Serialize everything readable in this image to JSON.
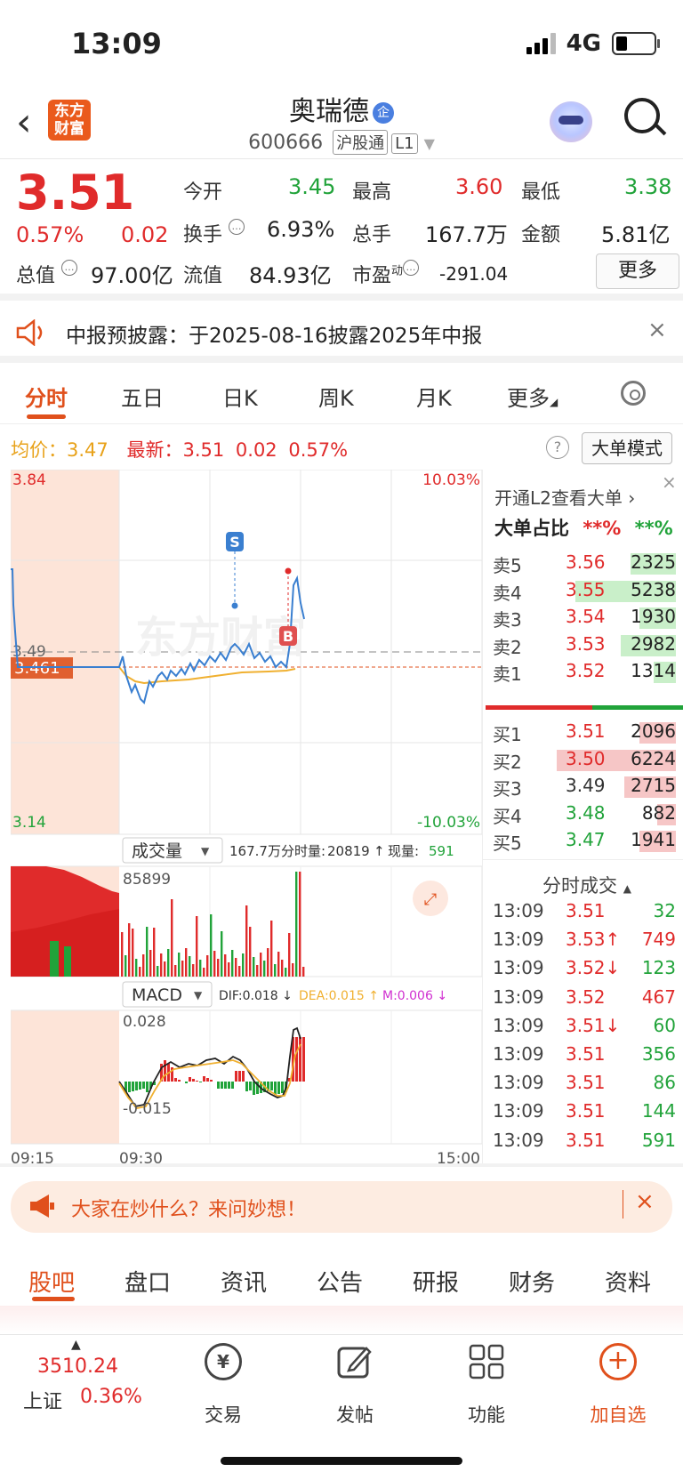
{
  "status_bar": {
    "time": "13:09",
    "network": "4G"
  },
  "header": {
    "logo_text": "东方财富",
    "stock_name": "奥瑞德",
    "badge": "企",
    "code": "600666",
    "tag1": "沪股通",
    "tag2": "L1"
  },
  "quote": {
    "price": "3.51",
    "change_pct": "0.57%",
    "change": "0.02",
    "open_label": "今开",
    "open": "3.45",
    "high_label": "最高",
    "high": "3.60",
    "low_label": "最低",
    "low": "3.38",
    "turnover_label": "换手",
    "turnover": "6.93%",
    "volume_label": "总手",
    "volume": "167.7万",
    "amount_label": "金额",
    "amount": "5.81亿",
    "mcap_label": "总值",
    "mcap": "97.00亿",
    "float_label": "流值",
    "float_cap": "84.93亿",
    "pe_label": "市盈",
    "pe_sup": "动",
    "pe": "-291.04",
    "more": "更多"
  },
  "notice": {
    "text": "中报预披露：于2025-08-16披露2025年中报"
  },
  "tabs": [
    "分时",
    "五日",
    "日K",
    "周K",
    "月K",
    "更多"
  ],
  "avg_row": {
    "avg_label": "均价：",
    "avg": "3.47",
    "latest_label": "最新：",
    "latest": "3.51",
    "chg": "0.02",
    "pct": "0.57%",
    "mode": "大单模式"
  },
  "chart": {
    "top_price": "3.84",
    "top_pct": "10.03%",
    "bottom_price": "3.14",
    "bottom_pct": "-10.03%",
    "mid_price": "3.49",
    "cursor_price": "3.461",
    "marker_s": "S",
    "marker_b": "B"
  },
  "volume_panel": {
    "selector": "成交量",
    "total": "167.7万",
    "fen_label": "分时量:",
    "fen": "20819",
    "arrow": "↑",
    "now_label": "现量:",
    "now": "591",
    "max": "85899"
  },
  "macd_panel": {
    "selector": "MACD",
    "dif": "DIF:0.018 ↓",
    "dea": "DEA:0.015 ↑",
    "m": "M:0.006 ↓",
    "max": "0.028",
    "min": "-0.015"
  },
  "time_axis": [
    "09:15",
    "09:30",
    "15:00"
  ],
  "orderbook": {
    "promo": "开通L2查看大单",
    "ratio_label": "大单占比",
    "ratio_sell": "**%",
    "ratio_buy": "**%",
    "sells": [
      {
        "label": "卖5",
        "price": "3.56",
        "vol": "2325",
        "w": 0.25
      },
      {
        "label": "卖4",
        "price": "3.55",
        "vol": "5238",
        "w": 0.55
      },
      {
        "label": "卖3",
        "price": "3.54",
        "vol": "1930",
        "w": 0.2
      },
      {
        "label": "卖2",
        "price": "3.53",
        "vol": "2982",
        "w": 0.3
      },
      {
        "label": "卖1",
        "price": "3.52",
        "vol": "1314",
        "w": 0.12
      }
    ],
    "buys": [
      {
        "label": "买1",
        "price": "3.51",
        "vol": "2096",
        "w": 0.2
      },
      {
        "label": "买2",
        "price": "3.50",
        "vol": "6224",
        "w": 0.65
      },
      {
        "label": "买3",
        "price": "3.49",
        "vol": "2715",
        "w": 0.28
      },
      {
        "label": "买4",
        "price": "3.48",
        "vol": "882",
        "w": 0.1
      },
      {
        "label": "买5",
        "price": "3.47",
        "vol": "1941",
        "w": 0.2
      }
    ]
  },
  "trades": {
    "title": "分时成交",
    "rows": [
      {
        "t": "13:09",
        "p": "3.51",
        "v": "32",
        "c": "green"
      },
      {
        "t": "13:09",
        "p": "3.53↑",
        "v": "749",
        "c": "red"
      },
      {
        "t": "13:09",
        "p": "3.52↓",
        "v": "123",
        "c": "green"
      },
      {
        "t": "13:09",
        "p": "3.52",
        "v": "467",
        "c": "red"
      },
      {
        "t": "13:09",
        "p": "3.51↓",
        "v": "60",
        "c": "green"
      },
      {
        "t": "13:09",
        "p": "3.51",
        "v": "356",
        "c": "green"
      },
      {
        "t": "13:09",
        "p": "3.51",
        "v": "86",
        "c": "green"
      },
      {
        "t": "13:09",
        "p": "3.51",
        "v": "144",
        "c": "green"
      },
      {
        "t": "13:09",
        "p": "3.51",
        "v": "591",
        "c": "green"
      }
    ]
  },
  "ask": {
    "text": "大家在炒什么？来问妙想！"
  },
  "lower_tabs": [
    "股吧",
    "盘口",
    "资讯",
    "公告",
    "研报",
    "财务",
    "资料"
  ],
  "bottom": {
    "index_value": "3510.24",
    "index_name": "上证",
    "index_pct": "0.36%",
    "nav": [
      "交易",
      "发帖",
      "功能",
      "加自选"
    ]
  },
  "colors": {
    "up": "#e02b2b",
    "down": "#21a33a",
    "accent": "#e0501c"
  }
}
